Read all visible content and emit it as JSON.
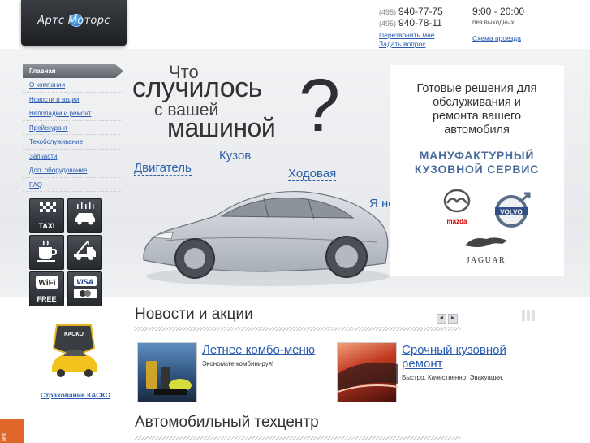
{
  "header": {
    "logo_text": "Артс Моторс",
    "phones": [
      {
        "code": "(495)",
        "number": "940-77-75"
      },
      {
        "code": "(495)",
        "number": "940-78-11"
      }
    ],
    "callback_label": "Перезвонить мне",
    "ask_label": "Задать вопрос",
    "hours": "9:00 - 20:00",
    "hours_note": "без выходных",
    "map_label": "Схема проезда"
  },
  "sidebar": {
    "items": [
      {
        "label": "Главная",
        "active": true
      },
      {
        "label": "О компании"
      },
      {
        "label": "Новости и акции"
      },
      {
        "label": "Неполадки и ремонт"
      },
      {
        "label": "Прейскурант"
      },
      {
        "label": "Техобслуживание"
      },
      {
        "label": "Запчасти"
      },
      {
        "label": "Доп. оборудование"
      },
      {
        "label": "FAQ"
      }
    ],
    "services": [
      {
        "icon": "taxi-icon",
        "label": "TAXI"
      },
      {
        "icon": "car-wash-icon",
        "label": ""
      },
      {
        "icon": "coffee-icon",
        "label": ""
      },
      {
        "icon": "tow-truck-icon",
        "label": ""
      },
      {
        "icon": "wifi-icon",
        "label": "FREE"
      },
      {
        "icon": "payment-cards-icon",
        "label": "VISA"
      }
    ],
    "casco_badge": "КАСКО",
    "casco_link": "Страхование КАСКО",
    "side_tab": "ия"
  },
  "hero": {
    "line1": "Что",
    "line2": "случилось",
    "line3": "с вашей",
    "line4": "машиной",
    "question_mark": "?",
    "hotspots": {
      "engine": "Двигатель",
      "body": "Кузов",
      "chassis": "Ходовая",
      "dont_know": "Я не знаю :)"
    }
  },
  "promo": {
    "text_lines": [
      "Готовые решения для",
      "обслуживания и",
      "ремонта вашего",
      "автомобиля"
    ],
    "accent_lines": [
      "МАНУФАКТУРНЫЙ",
      "КУЗОВНОЙ СЕРВИС"
    ],
    "brands": [
      "mazda",
      "VOLVO",
      "JAGUAR"
    ]
  },
  "news": {
    "title": "Новости и акции",
    "prev_label": "◄",
    "next_label": "►",
    "items": [
      {
        "title": "Летнее комбо-меню",
        "desc": "Экономьте комбинируя!"
      },
      {
        "title_line1": "Срочный кузовной",
        "title_line2": "ремонт",
        "desc": "Быстро. Качественно. Эвакуация."
      }
    ]
  },
  "section2": {
    "title": "Автомобильный техцентр"
  },
  "colors": {
    "link": "#2a5db0",
    "accent": "#4a6c9c",
    "tab": "#e0662a"
  }
}
